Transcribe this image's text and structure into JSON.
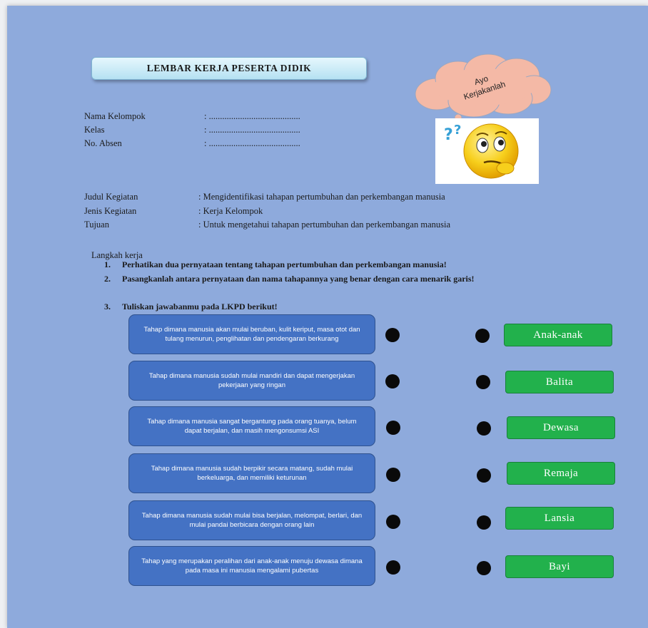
{
  "header": {
    "title": "LEMBAR KERJA PESERTA DIDIK",
    "cloud_line1": "Ayo",
    "cloud_line2": "Kerjakanlah"
  },
  "identity": [
    {
      "label": "Nama Kelompok",
      "value": ": ........................................."
    },
    {
      "label": "Kelas",
      "value": ": ........................................."
    },
    {
      "label": "No. Absen",
      "value": ": ........................................."
    }
  ],
  "activity": [
    {
      "label": "Judul Kegiatan",
      "value": ": Mengidentifikasi tahapan pertumbuhan dan perkembangan manusia"
    },
    {
      "label": "Jenis Kegiatan",
      "value": ": Kerja Kelompok"
    },
    {
      "label": "Tujuan",
      "value": ": Untuk mengetahui tahapan pertumbuhan dan perkembangan manusia"
    }
  ],
  "steps_heading": "Langkah kerja",
  "steps": [
    {
      "num": "1.",
      "text": "Perhatikan dua pernyataan tentang tahapan pertumbuhan dan perkembangan manusia!"
    },
    {
      "num": "2.",
      "text": "Pasangkanlah antara pernyataan dan nama tahapannya yang benar dengan cara menarik garis!"
    },
    {
      "num": "3.",
      "text": "Tuliskan jawabanmu pada LKPD berikut!"
    }
  ],
  "descriptions": [
    "Tahap dimana manusia akan mulai beruban, kulit keriput, masa otot dan tulang menurun, penglihatan dan pendengaran berkurang",
    "Tahap dimana manusia sudah mulai mandiri dan dapat mengerjakan pekerjaan yang ringan",
    "Tahap dimana manusia sangat bergantung pada orang tuanya, belum dapat berjalan, dan masih mengonsumsi ASI",
    "Tahap dimana manusia sudah berpikir secara matang, sudah mulai berkeluarga, dan memiliki keturunan",
    "Tahap dimana manusia sudah mulai bisa berjalan, melompat, berlari, dan mulai pandai berbicara dengan orang lain",
    "Tahap yang merupakan peralihan dari anak-anak menuju dewasa dimana pada masa ini manusia mengalami pubertas"
  ],
  "stages": [
    "Anak-anak",
    "Balita",
    "Dewasa",
    "Remaja",
    "Lansia",
    "Bayi"
  ],
  "colors": {
    "page_bg": "#8eaadc",
    "description_box": "#4472c4",
    "stage_box": "#22b14c",
    "cloud": "#f4b9a6"
  },
  "icons": {
    "cloud": "thought-cloud-icon",
    "smiley": "thinking-smiley-icon"
  }
}
